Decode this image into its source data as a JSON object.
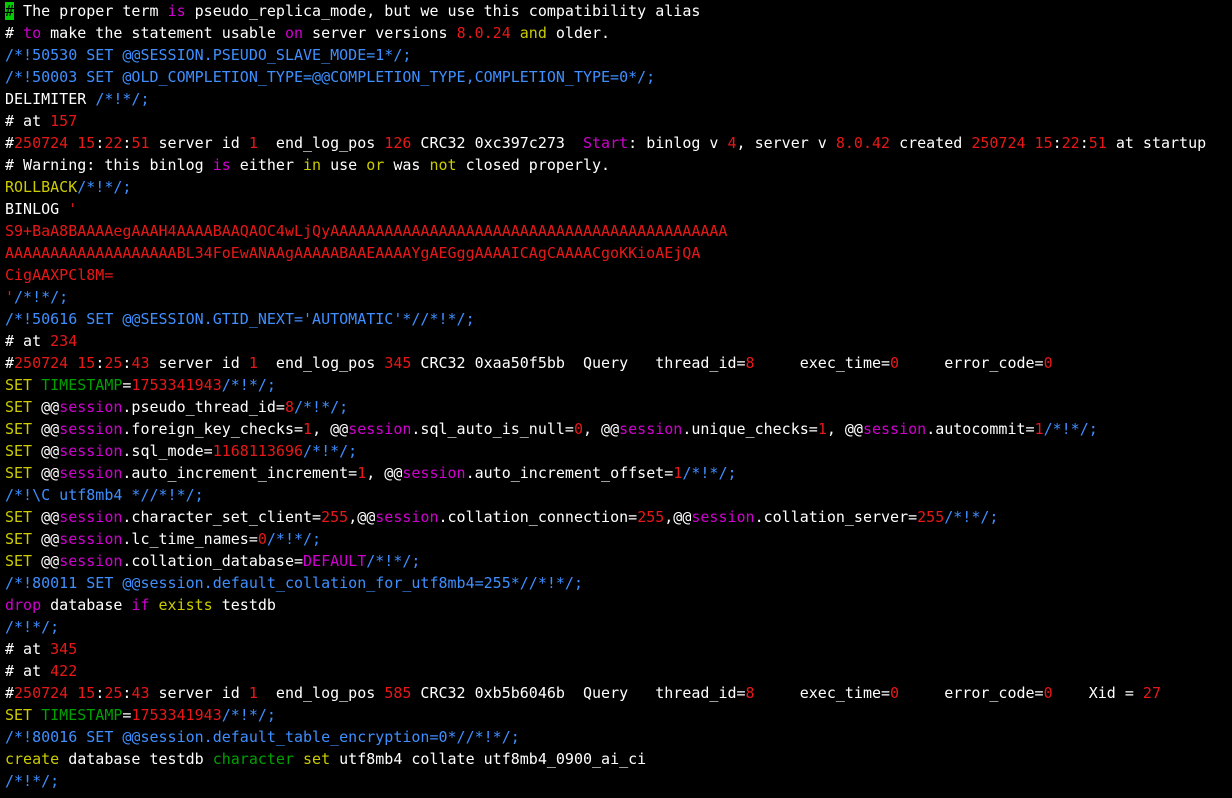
{
  "colors": {
    "background": "#000000",
    "default": "#ffffff",
    "comment": "#3f8fff",
    "number": "#e81818",
    "keyword": "#d000d0",
    "yellow_keyword": "#cccc00",
    "green_keyword": "#00a000",
    "cursor": "#00cc00"
  },
  "terminal": {
    "lines": [
      [
        [
          "cursor",
          "#"
        ],
        [
          "white",
          " The proper term "
        ],
        [
          "magenta",
          "is"
        ],
        [
          "white",
          " pseudo_replica_mode, but we use this compatibility alias"
        ]
      ],
      [
        [
          "white",
          "# "
        ],
        [
          "magenta",
          "to"
        ],
        [
          "white",
          " make the statement usable "
        ],
        [
          "magenta",
          "on"
        ],
        [
          "white",
          " server versions "
        ],
        [
          "red",
          "8.0.24"
        ],
        [
          "white",
          " "
        ],
        [
          "yellow",
          "and"
        ],
        [
          "white",
          " older."
        ]
      ],
      [
        [
          "blue",
          "/*!50530 SET @@SESSION.PSEUDO_SLAVE_MODE=1*/;"
        ]
      ],
      [
        [
          "blue",
          "/*!50003 SET @OLD_COMPLETION_TYPE=@@COMPLETION_TYPE,COMPLETION_TYPE=0*/;"
        ]
      ],
      [
        [
          "white",
          "DELIMITER "
        ],
        [
          "blue",
          "/*!*/;"
        ]
      ],
      [
        [
          "white",
          "# at "
        ],
        [
          "red",
          "157"
        ]
      ],
      [
        [
          "white",
          "#"
        ],
        [
          "red",
          "250724 15"
        ],
        [
          "white",
          ":"
        ],
        [
          "red",
          "22"
        ],
        [
          "white",
          ":"
        ],
        [
          "red",
          "51"
        ],
        [
          "white",
          " server id "
        ],
        [
          "red",
          "1"
        ],
        [
          "white",
          "  end_log_pos "
        ],
        [
          "red",
          "126"
        ],
        [
          "white",
          " CRC32 0xc397c273  "
        ],
        [
          "magenta",
          "Start"
        ],
        [
          "white",
          ": binlog v "
        ],
        [
          "red",
          "4"
        ],
        [
          "white",
          ", server v "
        ],
        [
          "red",
          "8.0.42"
        ],
        [
          "white",
          " created "
        ],
        [
          "red",
          "250724 15"
        ],
        [
          "white",
          ":"
        ],
        [
          "red",
          "22"
        ],
        [
          "white",
          ":"
        ],
        [
          "red",
          "51"
        ],
        [
          "white",
          " at startup"
        ]
      ],
      [
        [
          "white",
          "# Warning: this binlog "
        ],
        [
          "magenta",
          "is"
        ],
        [
          "white",
          " either "
        ],
        [
          "yellow",
          "in"
        ],
        [
          "white",
          " use "
        ],
        [
          "yellow",
          "or"
        ],
        [
          "white",
          " was "
        ],
        [
          "yellow",
          "not"
        ],
        [
          "white",
          " closed properly."
        ]
      ],
      [
        [
          "yellow",
          "ROLLBACK"
        ],
        [
          "blue",
          "/*!*/;"
        ]
      ],
      [
        [
          "white",
          "BINLOG "
        ],
        [
          "red",
          "'"
        ]
      ],
      [
        [
          "red",
          "S9+BaA8BAAAAegAAAH4AAAABAAQAOC4wLjQyAAAAAAAAAAAAAAAAAAAAAAAAAAAAAAAAAAAAAAAAAAAA"
        ]
      ],
      [
        [
          "red",
          "AAAAAAAAAAAAAAAAAAABL34FoEwANAAgAAAAABAAEAAAAYgAEGggAAAAICAgCAAAACgoKKioAEjQA"
        ]
      ],
      [
        [
          "red",
          "CigAAXPCl8M="
        ]
      ],
      [
        [
          "red",
          "'"
        ],
        [
          "blue",
          "/*!*/;"
        ]
      ],
      [
        [
          "blue",
          "/*!50616 SET @@SESSION.GTID_NEXT='AUTOMATIC'*//*!*/;"
        ]
      ],
      [
        [
          "white",
          "# at "
        ],
        [
          "red",
          "234"
        ]
      ],
      [
        [
          "white",
          "#"
        ],
        [
          "red",
          "250724 15"
        ],
        [
          "white",
          ":"
        ],
        [
          "red",
          "25"
        ],
        [
          "white",
          ":"
        ],
        [
          "red",
          "43"
        ],
        [
          "white",
          " server id "
        ],
        [
          "red",
          "1"
        ],
        [
          "white",
          "  end_log_pos "
        ],
        [
          "red",
          "345"
        ],
        [
          "white",
          " CRC32 0xaa50f5bb  Query   thread_id="
        ],
        [
          "red",
          "8"
        ],
        [
          "white",
          "     exec_time="
        ],
        [
          "red",
          "0"
        ],
        [
          "white",
          "     error_code="
        ],
        [
          "red",
          "0"
        ]
      ],
      [
        [
          "yellow",
          "SET"
        ],
        [
          "white",
          " "
        ],
        [
          "green",
          "TIMESTAMP"
        ],
        [
          "white",
          "="
        ],
        [
          "red",
          "1753341943"
        ],
        [
          "blue",
          "/*!*/;"
        ]
      ],
      [
        [
          "yellow",
          "SET"
        ],
        [
          "white",
          " @@"
        ],
        [
          "magenta",
          "session"
        ],
        [
          "white",
          ".pseudo_thread_id="
        ],
        [
          "red",
          "8"
        ],
        [
          "blue",
          "/*!*/;"
        ]
      ],
      [
        [
          "yellow",
          "SET"
        ],
        [
          "white",
          " @@"
        ],
        [
          "magenta",
          "session"
        ],
        [
          "white",
          ".foreign_key_checks="
        ],
        [
          "red",
          "1"
        ],
        [
          "white",
          ", @@"
        ],
        [
          "magenta",
          "session"
        ],
        [
          "white",
          ".sql_auto_is_null="
        ],
        [
          "red",
          "0"
        ],
        [
          "white",
          ", @@"
        ],
        [
          "magenta",
          "session"
        ],
        [
          "white",
          ".unique_checks="
        ],
        [
          "red",
          "1"
        ],
        [
          "white",
          ", @@"
        ],
        [
          "magenta",
          "session"
        ],
        [
          "white",
          ".autocommit="
        ],
        [
          "red",
          "1"
        ],
        [
          "blue",
          "/*!*/;"
        ]
      ],
      [
        [
          "yellow",
          "SET"
        ],
        [
          "white",
          " @@"
        ],
        [
          "magenta",
          "session"
        ],
        [
          "white",
          ".sql_mode="
        ],
        [
          "red",
          "1168113696"
        ],
        [
          "blue",
          "/*!*/;"
        ]
      ],
      [
        [
          "yellow",
          "SET"
        ],
        [
          "white",
          " @@"
        ],
        [
          "magenta",
          "session"
        ],
        [
          "white",
          ".auto_increment_increment="
        ],
        [
          "red",
          "1"
        ],
        [
          "white",
          ", @@"
        ],
        [
          "magenta",
          "session"
        ],
        [
          "white",
          ".auto_increment_offset="
        ],
        [
          "red",
          "1"
        ],
        [
          "blue",
          "/*!*/;"
        ]
      ],
      [
        [
          "blue",
          "/*!\\C utf8mb4 *//*!*/;"
        ]
      ],
      [
        [
          "yellow",
          "SET"
        ],
        [
          "white",
          " @@"
        ],
        [
          "magenta",
          "session"
        ],
        [
          "white",
          ".character_set_client="
        ],
        [
          "red",
          "255"
        ],
        [
          "white",
          ",@@"
        ],
        [
          "magenta",
          "session"
        ],
        [
          "white",
          ".collation_connection="
        ],
        [
          "red",
          "255"
        ],
        [
          "white",
          ",@@"
        ],
        [
          "magenta",
          "session"
        ],
        [
          "white",
          ".collation_server="
        ],
        [
          "red",
          "255"
        ],
        [
          "blue",
          "/*!*/;"
        ]
      ],
      [
        [
          "yellow",
          "SET"
        ],
        [
          "white",
          " @@"
        ],
        [
          "magenta",
          "session"
        ],
        [
          "white",
          ".lc_time_names="
        ],
        [
          "red",
          "0"
        ],
        [
          "blue",
          "/*!*/;"
        ]
      ],
      [
        [
          "yellow",
          "SET"
        ],
        [
          "white",
          " @@"
        ],
        [
          "magenta",
          "session"
        ],
        [
          "white",
          ".collation_database="
        ],
        [
          "magenta",
          "DEFAULT"
        ],
        [
          "blue",
          "/*!*/;"
        ]
      ],
      [
        [
          "blue",
          "/*!80011 SET @@session.default_collation_for_utf8mb4=255*//*!*/;"
        ]
      ],
      [
        [
          "magenta",
          "drop"
        ],
        [
          "white",
          " database "
        ],
        [
          "magenta",
          "if"
        ],
        [
          "white",
          " "
        ],
        [
          "yellow",
          "exists"
        ],
        [
          "white",
          " testdb"
        ]
      ],
      [
        [
          "blue",
          "/*!*/;"
        ]
      ],
      [
        [
          "white",
          "# at "
        ],
        [
          "red",
          "345"
        ]
      ],
      [
        [
          "white",
          "# at "
        ],
        [
          "red",
          "422"
        ]
      ],
      [
        [
          "white",
          "#"
        ],
        [
          "red",
          "250724 15"
        ],
        [
          "white",
          ":"
        ],
        [
          "red",
          "25"
        ],
        [
          "white",
          ":"
        ],
        [
          "red",
          "43"
        ],
        [
          "white",
          " server id "
        ],
        [
          "red",
          "1"
        ],
        [
          "white",
          "  end_log_pos "
        ],
        [
          "red",
          "585"
        ],
        [
          "white",
          " CRC32 0xb5b6046b  Query   thread_id="
        ],
        [
          "red",
          "8"
        ],
        [
          "white",
          "     exec_time="
        ],
        [
          "red",
          "0"
        ],
        [
          "white",
          "     error_code="
        ],
        [
          "red",
          "0"
        ],
        [
          "white",
          "    Xid = "
        ],
        [
          "red",
          "27"
        ]
      ],
      [
        [
          "yellow",
          "SET"
        ],
        [
          "white",
          " "
        ],
        [
          "green",
          "TIMESTAMP"
        ],
        [
          "white",
          "="
        ],
        [
          "red",
          "1753341943"
        ],
        [
          "blue",
          "/*!*/;"
        ]
      ],
      [
        [
          "blue",
          "/*!80016 SET @@session.default_table_encryption=0*//*!*/;"
        ]
      ],
      [
        [
          "yellow",
          "create"
        ],
        [
          "white",
          " database testdb "
        ],
        [
          "green",
          "character"
        ],
        [
          "white",
          " "
        ],
        [
          "yellow",
          "set"
        ],
        [
          "white",
          " utf8mb4 collate utf8mb4_0900_ai_ci"
        ]
      ],
      [
        [
          "blue",
          "/*!*/;"
        ]
      ]
    ]
  }
}
